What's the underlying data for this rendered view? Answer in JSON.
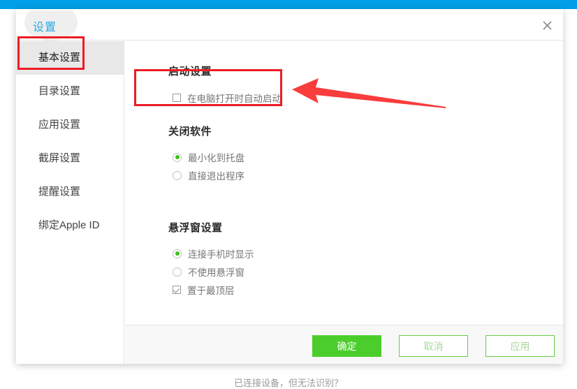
{
  "window": {
    "title": "设置",
    "close_icon": "close-icon"
  },
  "sidebar": {
    "items": [
      {
        "label": "基本设置",
        "selected": true
      },
      {
        "label": "目录设置",
        "selected": false
      },
      {
        "label": "应用设置",
        "selected": false
      },
      {
        "label": "截屏设置",
        "selected": false
      },
      {
        "label": "提醒设置",
        "selected": false
      },
      {
        "label": "绑定Apple ID",
        "selected": false
      }
    ]
  },
  "main": {
    "sections": [
      {
        "heading": "启动设置",
        "options": [
          {
            "label": "在电脑打开时自动启动",
            "type": "checkbox",
            "checked": false
          }
        ]
      },
      {
        "heading": "关闭软件",
        "options": [
          {
            "label": "最小化到托盘",
            "type": "radio",
            "checked": true
          },
          {
            "label": "直接退出程序",
            "type": "radio",
            "checked": false
          }
        ]
      },
      {
        "heading": "悬浮窗设置",
        "options": [
          {
            "label": "连接手机时显示",
            "type": "radio",
            "checked": true
          },
          {
            "label": "不使用悬浮窗",
            "type": "radio",
            "checked": false
          },
          {
            "label": "置于最顶层",
            "type": "checkbox",
            "checked": true
          }
        ]
      }
    ]
  },
  "footer": {
    "ok_label": "确定",
    "cancel_label": "取消",
    "apply_label": "应用"
  },
  "status": {
    "text": "已连接设备，但无法识别？"
  },
  "annotations": {
    "color": "#ed1c24",
    "arrow_direction": "left",
    "arrow_target": "在电脑打开时自动启动"
  },
  "colors": {
    "top_bar": "#009fe8",
    "title_blue": "#2aa9e8",
    "primary_green": "#4bce2b",
    "radio_green": "#3dc21b",
    "selected_sidebar_bg": "#e8e8e8",
    "footer_bg": "#f8f8f8"
  }
}
